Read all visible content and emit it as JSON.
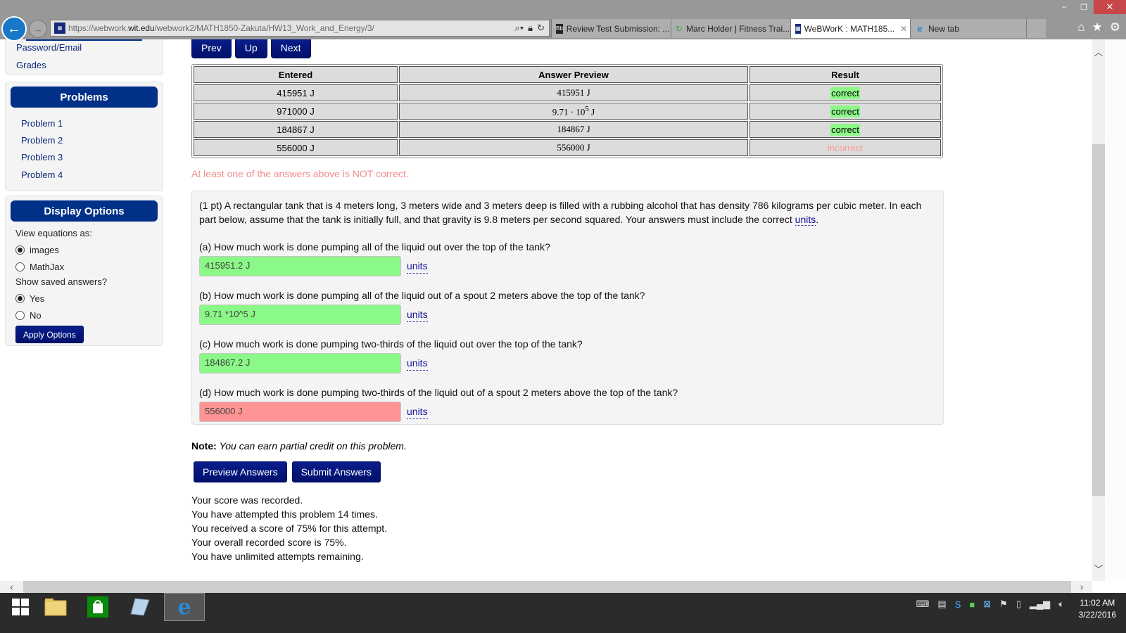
{
  "browser": {
    "url_prefix": "https://webwork.",
    "url_domain": "wit.edu",
    "url_path": "/webwork2/MATH1850-Zakuta/HW13_Work_and_Energy/3/",
    "tabs": [
      {
        "label": "Review Test Submission: ...",
        "icon": "blackboard-icon",
        "active": false
      },
      {
        "label": "Marc Holder | Fitness Trai...",
        "icon": "refresh-page-icon",
        "active": false
      },
      {
        "label": "WeBWorK : MATH185...",
        "icon": "webwork-icon",
        "active": true
      },
      {
        "label": "New tab",
        "icon": "ie-icon",
        "active": false
      }
    ],
    "window_controls": {
      "minimize": "–",
      "restore": "❐",
      "close": "✕"
    },
    "icons": {
      "home": "⌂",
      "favorites": "★",
      "settings": "⚙"
    }
  },
  "sidebar": {
    "account_links": [
      "Password/Email",
      "Grades"
    ],
    "problems": {
      "title": "Problems",
      "items": [
        "Problem 1",
        "Problem 2",
        "Problem 3",
        "Problem 4"
      ]
    },
    "display_options": {
      "title": "Display Options",
      "view_equations_label": "View equations as:",
      "view_equations_options": [
        {
          "label": "images",
          "selected": true
        },
        {
          "label": "MathJax",
          "selected": false
        }
      ],
      "show_saved_label": "Show saved answers?",
      "show_saved_options": [
        {
          "label": "Yes",
          "selected": true
        },
        {
          "label": "No",
          "selected": false
        }
      ],
      "apply_button": "Apply Options"
    }
  },
  "main": {
    "nav_buttons": [
      "Prev",
      "Up",
      "Next"
    ],
    "results_table": {
      "headers": [
        "Entered",
        "Answer Preview",
        "Result"
      ],
      "rows": [
        {
          "entered": "415951 J",
          "preview": "415951 J",
          "preview_exp": "",
          "result": "correct"
        },
        {
          "entered": "971000 J",
          "preview": "9.71 · 10",
          "preview_exp": "5",
          "preview_suffix": " J",
          "result": "correct"
        },
        {
          "entered": "184867 J",
          "preview": "184867 J",
          "preview_exp": "",
          "result": "correct"
        },
        {
          "entered": "556000 J",
          "preview": "556000 J",
          "preview_exp": "",
          "result": "incorrect"
        }
      ]
    },
    "warning": "At least one of the answers above is NOT correct.",
    "problem": {
      "intro": "(1 pt) A rectangular tank that is 4 meters long, 3 meters wide and 3 meters deep is filled with a rubbing alcohol that has density 786 kilograms per cubic meter. In each part below, assume that the tank is initially full, and that gravity is 9.8 meters per second squared. Your answers must include the correct ",
      "intro_link": "units",
      "intro_end": ".",
      "units_label": "units",
      "parts": [
        {
          "question": "(a) How much work is done pumping all of the liquid out over the top of the tank?",
          "answer": "415951.2 J",
          "status": "correct"
        },
        {
          "question": "(b) How much work is done pumping all of the liquid out of a spout 2 meters above the top of the tank?",
          "answer": "9.71 *10^5 J",
          "status": "correct"
        },
        {
          "question": "(c) How much work is done pumping two-thirds of the liquid out over the top of the tank?",
          "answer": "184867.2 J",
          "status": "correct"
        },
        {
          "question": "(d) How much work is done pumping two-thirds of the liquid out of a spout 2 meters above the top of the tank?",
          "answer": "556000 J",
          "status": "incorrect"
        }
      ]
    },
    "note_label": "Note:",
    "note_text": "You can earn partial credit on this problem.",
    "preview_button": "Preview Answers",
    "submit_button": "Submit Answers",
    "score_lines": [
      "Your score was recorded.",
      "You have attempted this problem 14 times.",
      "You received a score of 75% for this attempt.",
      "Your overall recorded score is 75%.",
      "You have unlimited attempts remaining."
    ]
  },
  "taskbar": {
    "time": "11:02 AM",
    "date": "3/22/2016"
  },
  "colors": {
    "navy": "#003087",
    "correct_bg": "#8bf987",
    "incorrect_bg": "#ff9494",
    "warning_text": "#f28c8c"
  }
}
